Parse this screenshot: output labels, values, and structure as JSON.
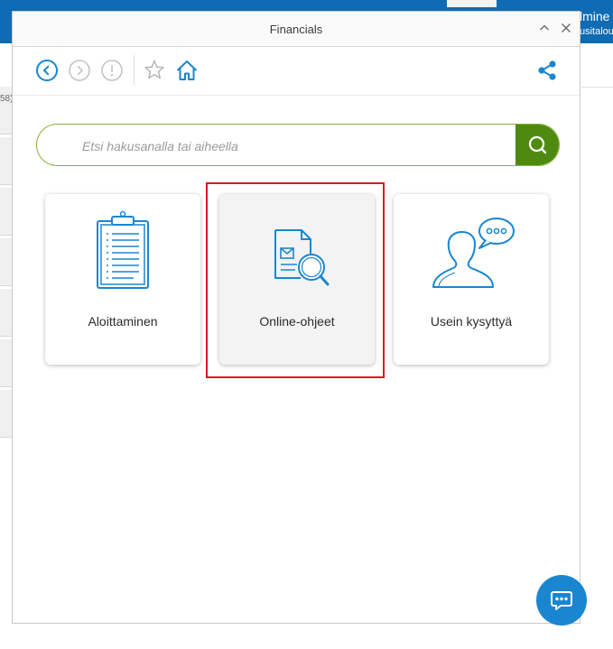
{
  "background": {
    "topbar_text_line1": "lmine",
    "topbar_text_line2": "usitalou",
    "left_cut_text": "58)"
  },
  "panel": {
    "title": "Financials"
  },
  "icons": {
    "minimize": "chevron-up-icon",
    "close": "close-icon",
    "back": "back-circle-icon",
    "forward": "forward-circle-icon",
    "alert": "exclamation-circle-icon",
    "favorite": "star-icon",
    "home": "home-icon",
    "share": "share-icon",
    "search": "search-icon",
    "chat": "chat-bubble-icon"
  },
  "search": {
    "placeholder": "Etsi hakusanalla tai aiheella",
    "value": ""
  },
  "cards": [
    {
      "label": "Aloittaminen",
      "icon": "clipboard-icon"
    },
    {
      "label": "Online-ohjeet",
      "icon": "document-search-icon",
      "selected": true
    },
    {
      "label": "Usein kysyttyä",
      "icon": "person-speech-bubble-icon"
    }
  ],
  "colors": {
    "accent_blue": "#1a86d0",
    "topbar_blue": "#0f6bb3",
    "search_green": "#4f8a10",
    "search_border": "#8bb13a",
    "highlight_red": "#e0141e"
  }
}
